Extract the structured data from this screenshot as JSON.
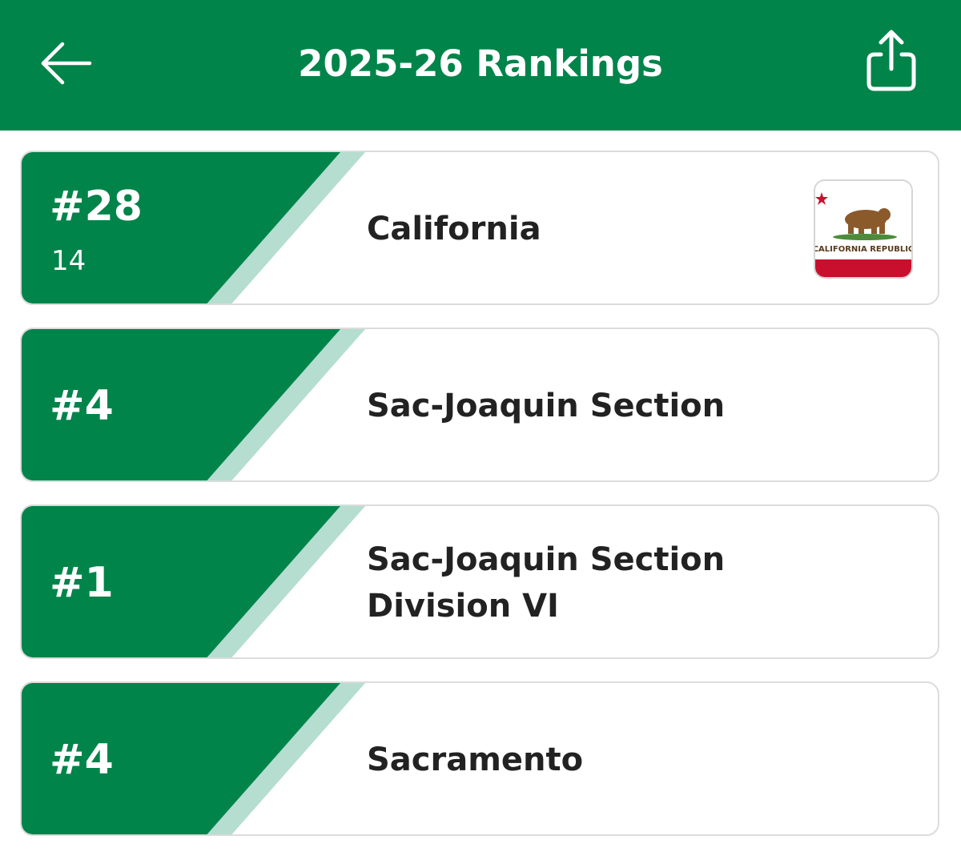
{
  "header": {
    "title": "2025-26 Rankings",
    "back_icon": "arrow-left-icon",
    "share_icon": "share-icon"
  },
  "colors": {
    "brand_green": "#00844a",
    "stripe_light_green": "#b5ddd0",
    "text_dark": "#222222"
  },
  "rankings": [
    {
      "rank": "#28",
      "subrank": "14",
      "name_line1": "California",
      "name_line2": "",
      "flag": "California Republic flag",
      "flag_text": "CALIFORNIA REPUBLIC"
    },
    {
      "rank": "#4",
      "subrank": "",
      "name_line1": "Sac-Joaquin Section",
      "name_line2": ""
    },
    {
      "rank": "#1",
      "subrank": "",
      "name_line1": "Sac-Joaquin Section",
      "name_line2": "Division VI"
    },
    {
      "rank": "#4",
      "subrank": "",
      "name_line1": "Sacramento",
      "name_line2": ""
    }
  ]
}
